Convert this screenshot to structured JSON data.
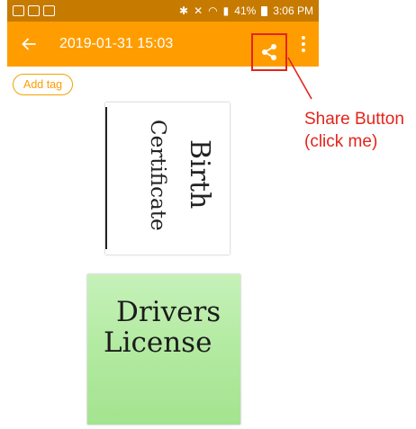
{
  "status_bar": {
    "time": "3:06 PM",
    "battery": "41%"
  },
  "app_bar": {
    "title": "2019-01-31 15:03"
  },
  "tags": {
    "add_label": "Add tag"
  },
  "documents": [
    {
      "name": "birth-certificate",
      "handwriting": [
        "Birth",
        "Certificate"
      ]
    },
    {
      "name": "drivers-license",
      "handwriting": [
        "Drivers",
        "License"
      ]
    }
  ],
  "annotation": {
    "line1": "Share Button",
    "line2": "(click me)",
    "color": "#e3241b"
  },
  "colors": {
    "app_bar": "#ff9d00",
    "status_bar": "#c77a00",
    "accent": "#ff9d00"
  }
}
